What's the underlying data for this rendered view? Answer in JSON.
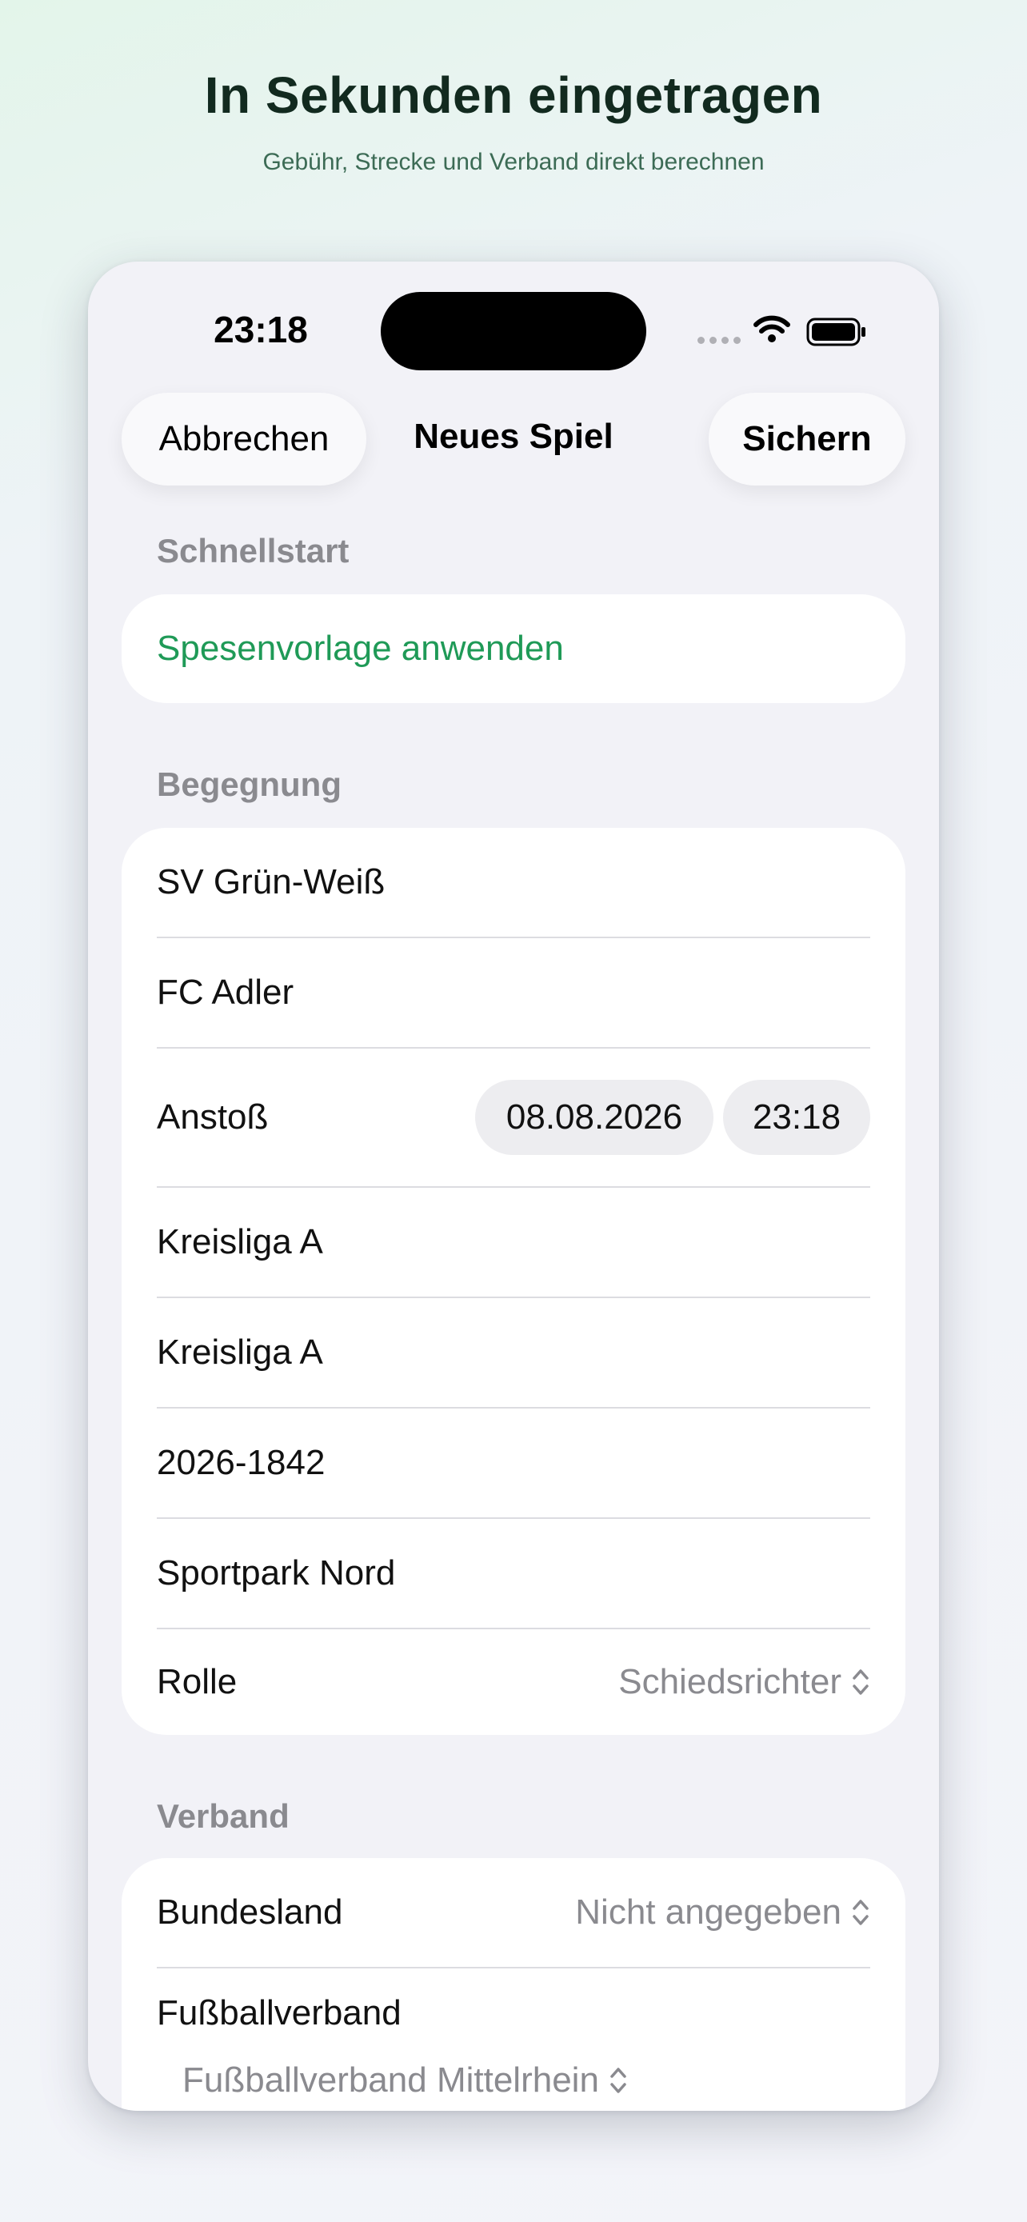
{
  "hero": {
    "title": "In Sekunden eingetragen",
    "subtitle": "Gebühr, Strecke und Verband direkt berechnen"
  },
  "status_bar": {
    "time": "23:18",
    "icons": [
      "cellular-signal-icon",
      "wifi-icon",
      "battery-icon"
    ]
  },
  "nav": {
    "cancel_label": "Abbrechen",
    "title": "Neues Spiel",
    "save_label": "Sichern"
  },
  "quickstart": {
    "header": "Schnellstart",
    "action_label": "Spesenvorlage anwenden"
  },
  "match": {
    "header": "Begegnung",
    "home_team": "SV Grün-Weiß",
    "away_team": "FC Adler",
    "kickoff_label": "Anstoß",
    "kickoff_date": "08.08.2026",
    "kickoff_time": "23:18",
    "league": "Kreisliga A",
    "league_class": "Kreisliga A",
    "match_number": "2026-1842",
    "venue": "Sportpark Nord",
    "role_label": "Rolle",
    "role_value": "Schiedsrichter"
  },
  "association": {
    "header": "Verband",
    "state_label": "Bundesland",
    "state_value": "Nicht angegeben",
    "federation_label": "Fußballverband",
    "federation_value": "Fußballverband Mittelrhein"
  },
  "colors": {
    "accent_green": "#1f9a57",
    "secondary_text": "#8a8a8f",
    "background": "#f2f2f7"
  }
}
